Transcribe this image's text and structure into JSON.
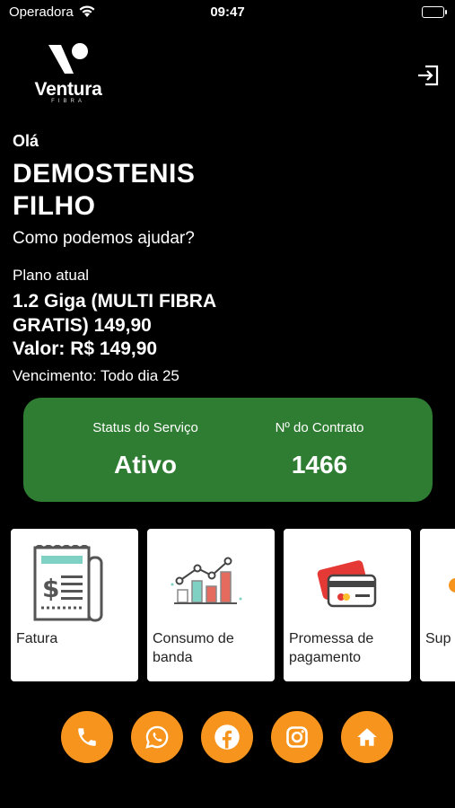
{
  "status_bar": {
    "carrier": "Operadora",
    "time": "09:47"
  },
  "logo": {
    "word": "Ventura",
    "sub": "FIBRA"
  },
  "greeting": "Olá",
  "user_name": "DEMOSTENIS FILHO",
  "help_text": "Como podemos ajudar?",
  "plan": {
    "label": "Plano atual",
    "name": "1.2 Giga (MULTI FIBRA GRATIS) 149,90",
    "value": "Valor: R$ 149,90",
    "due": "Vencimento: Todo dia 25"
  },
  "status_card": {
    "service_label": "Status do Serviço",
    "service_value": "Ativo",
    "contract_label": "Nº do Contrato",
    "contract_value": "1466",
    "color": "#2f7d32"
  },
  "tiles": [
    {
      "label": "Fatura",
      "icon": "invoice-icon"
    },
    {
      "label": "Consumo de banda",
      "icon": "bandwidth-chart-icon"
    },
    {
      "label": "Promessa de pagamento",
      "icon": "credit-card-icon"
    },
    {
      "label": "Sup",
      "icon": "support-icon"
    }
  ],
  "actions": [
    {
      "icon": "phone-icon"
    },
    {
      "icon": "whatsapp-icon"
    },
    {
      "icon": "facebook-icon"
    },
    {
      "icon": "instagram-icon"
    },
    {
      "icon": "home-icon"
    }
  ],
  "accent_color": "#f7941d"
}
